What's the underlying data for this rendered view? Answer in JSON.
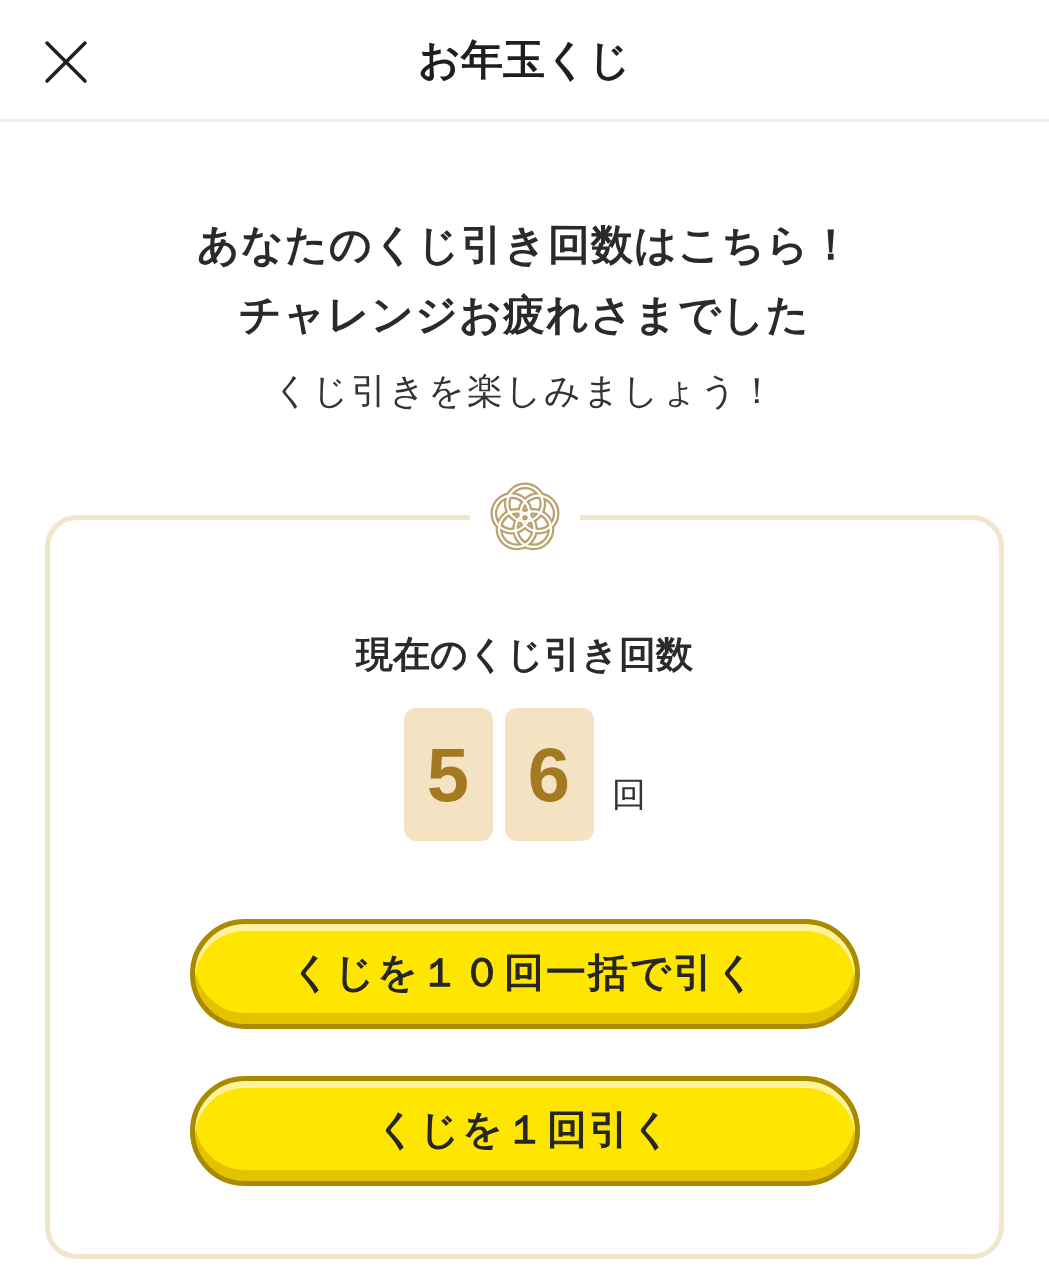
{
  "header": {
    "title": "お年玉くじ"
  },
  "intro": {
    "lines": [
      "あなたのくじ引き回数はこちら！",
      "チャレンジお疲れさまでした"
    ],
    "subtitle": "くじ引きを楽しみましょう！"
  },
  "counter": {
    "label": "現在のくじ引き回数",
    "digits": [
      "5",
      "6"
    ],
    "unit": "回"
  },
  "buttons": [
    {
      "label": "くじを１０回一括で引く"
    },
    {
      "label": "くじを１回引く"
    }
  ]
}
